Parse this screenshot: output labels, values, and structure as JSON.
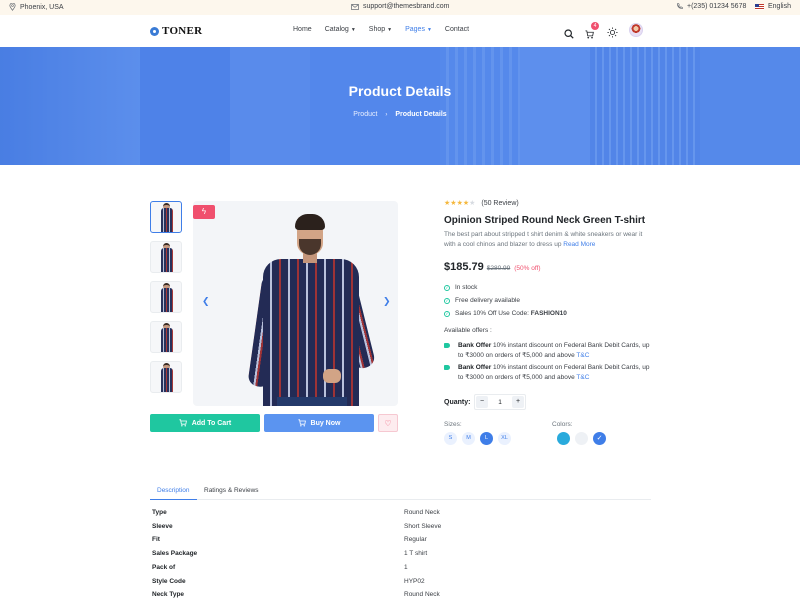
{
  "topbar": {
    "location": "Phoenix, USA",
    "email": "support@themesbrand.com",
    "phone": "+(235) 01234 5678",
    "language": "English"
  },
  "navbar": {
    "brand": "TONER",
    "menu": [
      {
        "label": "Home",
        "has_caret": false,
        "active": false
      },
      {
        "label": "Catalog",
        "has_caret": true,
        "active": false
      },
      {
        "label": "Shop",
        "has_caret": true,
        "active": false
      },
      {
        "label": "Pages",
        "has_caret": true,
        "active": true
      },
      {
        "label": "Contact",
        "has_caret": false,
        "active": false
      }
    ],
    "cart_count": "4",
    "icons": [
      "search-icon",
      "cart-icon",
      "sun-icon",
      "avatar"
    ]
  },
  "hero": {
    "title": "Product Details",
    "breadcrumb": {
      "parent": "Product",
      "current": "Product Details"
    }
  },
  "product": {
    "rating_stars": 4.5,
    "reviews": "(50 Review)",
    "title": "Opinion Striped Round Neck Green T-shirt",
    "description": "The best part about stripped t shirt denim & white sneakers or wear it with a cool chinos and blazer to dress up",
    "read_more": "Read More",
    "price": "$185.79",
    "old_price": "$280.99",
    "discount": "(50% off)",
    "features": [
      "In stock",
      "Free delivery available"
    ],
    "coupon_prefix": "Sales 10% Off Use Code: ",
    "coupon_code": "FASHION10",
    "offers_title": "Available offers :",
    "offers": [
      {
        "title": "Bank Offer",
        "text": " 10% instant discount on Federal Bank Debit Cards, up to ₹3000 on orders of ₹5,000 and above ",
        "link": "T&C"
      },
      {
        "title": "Bank Offer",
        "text": " 10% instant discount on Federal Bank Debit Cards, up to ₹3000 on orders of ₹5,000 and above ",
        "link": "T&C"
      }
    ],
    "quantity_label": "Quanty:",
    "quantity": "1",
    "minus": "−",
    "plus": "+",
    "sizes_label": "Sizes:",
    "sizes": [
      "S",
      "M",
      "L",
      "XL"
    ],
    "selected_size": "L",
    "colors_label": "Colors:",
    "colors": [
      "#29aadc",
      "#eef1f5",
      "#3f7ee8"
    ],
    "selected_color": "#3f7ee8",
    "add_to_cart": "Add To Cart",
    "buy_now": "Buy Now"
  },
  "tabs": [
    "Description",
    "Ratings & Reviews"
  ],
  "specs": [
    {
      "key": "Type",
      "value": "Round Neck"
    },
    {
      "key": "Sleeve",
      "value": "Short Sleeve"
    },
    {
      "key": "Fit",
      "value": "Regular"
    },
    {
      "key": "Sales Package",
      "value": "1 T shirt"
    },
    {
      "key": "Pack of",
      "value": "1"
    },
    {
      "key": "Style Code",
      "value": "HYP02"
    },
    {
      "key": "Neck Type",
      "value": "Round Neck"
    }
  ]
}
